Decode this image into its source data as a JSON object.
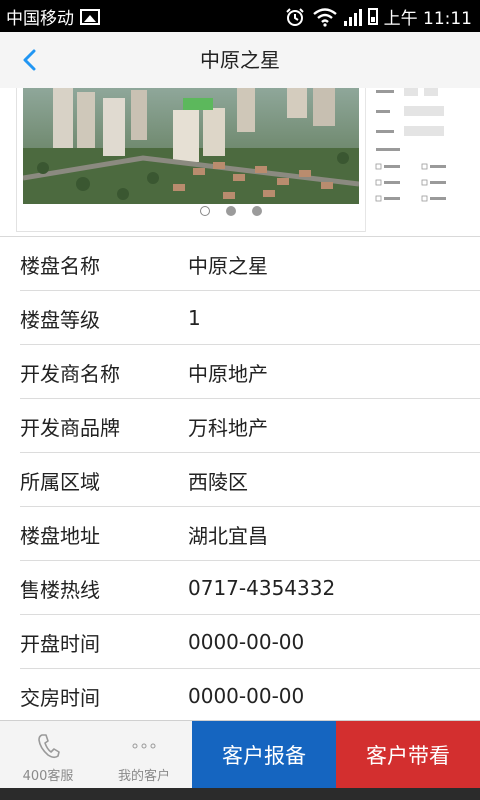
{
  "status_bar": {
    "carrier": "中国移动",
    "time": "上午 11:11",
    "icons": [
      "image-icon",
      "alarm-icon",
      "wifi-icon",
      "signal-icon",
      "battery-icon"
    ]
  },
  "header": {
    "title": "中原之星",
    "back_icon": "chevron-left-icon"
  },
  "banner": {
    "slides": 3,
    "active_slide": 1
  },
  "details": [
    {
      "label": "楼盘名称",
      "value": "中原之星"
    },
    {
      "label": "楼盘等级",
      "value": "1"
    },
    {
      "label": "开发商名称",
      "value": "中原地产"
    },
    {
      "label": "开发商品牌",
      "value": "万科地产"
    },
    {
      "label": "所属区域",
      "value": "西陵区"
    },
    {
      "label": "楼盘地址",
      "value": "湖北宜昌"
    },
    {
      "label": "售楼热线",
      "value": "0717-4354332"
    },
    {
      "label": "开盘时间",
      "value": "0000-00-00"
    },
    {
      "label": "交房时间",
      "value": "0000-00-00"
    }
  ],
  "bottom_bar": {
    "service_label": "400客服",
    "customers_label": "我的客户",
    "report_label": "客户报备",
    "tour_label": "客户带看",
    "colors": {
      "report": "#1565c0",
      "tour": "#d32f2f",
      "accent": "#2196f3"
    }
  }
}
